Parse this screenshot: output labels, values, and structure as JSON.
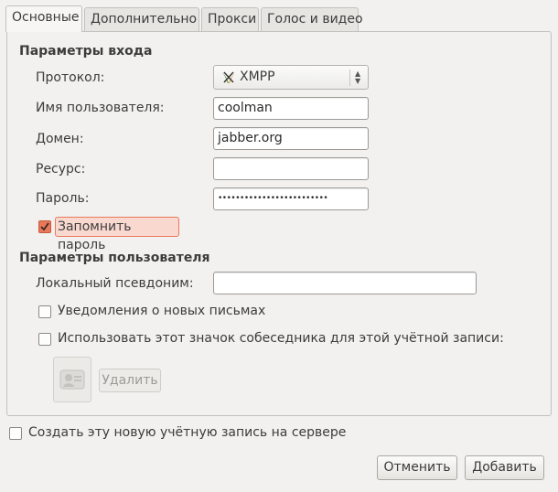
{
  "tabs": [
    {
      "label": "Основные"
    },
    {
      "label": "Дополнительно"
    },
    {
      "label": "Прокси"
    },
    {
      "label": "Голос и видео"
    }
  ],
  "login": {
    "section_title": "Параметры входа",
    "protocol_label": "Протокол:",
    "protocol_value": "XMPP",
    "username_label": "Имя пользователя:",
    "username_value": "coolman",
    "domain_label": "Домен:",
    "domain_value": "jabber.org",
    "resource_label": "Ресурс:",
    "resource_value": "",
    "password_label": "Пароль:",
    "password_value": "•••••••••••••••••••••••••",
    "remember_label": "Запомнить пароль",
    "remember_checked": true
  },
  "user": {
    "section_title": "Параметры пользователя",
    "alias_label": "Локальный псевдоним:",
    "alias_value": "",
    "mail_notify_label": "Уведомления о новых письмах",
    "buddy_icon_label": "Использовать этот значок собеседника для этой учётной записи:",
    "remove_label": "Удалить"
  },
  "register_label": "Создать эту новую учётную запись на сервере",
  "buttons": {
    "cancel": "Отменить",
    "add": "Добавить"
  },
  "colors": {
    "accent": "#e9785a",
    "window_bg": "#f2f1f0"
  }
}
